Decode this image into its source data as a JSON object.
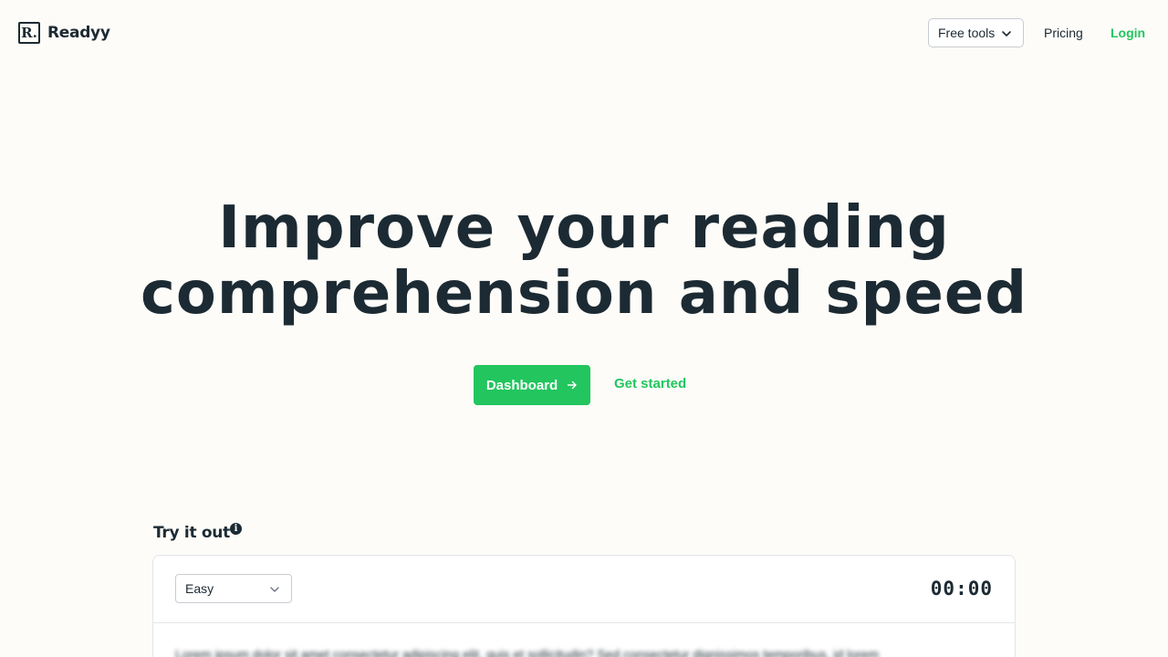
{
  "header": {
    "logo_mark": "R.",
    "logo_text": "Readyy",
    "free_tools_label": "Free tools",
    "pricing_label": "Pricing",
    "login_label": "Login"
  },
  "hero": {
    "title_line1": "Improve your reading",
    "title_line2": "comprehension and speed",
    "dashboard_label": "Dashboard",
    "get_started_label": "Get started"
  },
  "try_it": {
    "title": "Try it out",
    "info_icon": "info-icon",
    "difficulty": "Easy",
    "timer": "00:00",
    "preview_text": "Lorem ipsum dolor sit amet consectetur adipiscing elit, quis et sollicitudin? Sed consectetur dignissimos temporibus, id lorem"
  },
  "colors": {
    "accent": "#22c55e",
    "text": "#1c2a33",
    "background": "#fdfcf8"
  }
}
